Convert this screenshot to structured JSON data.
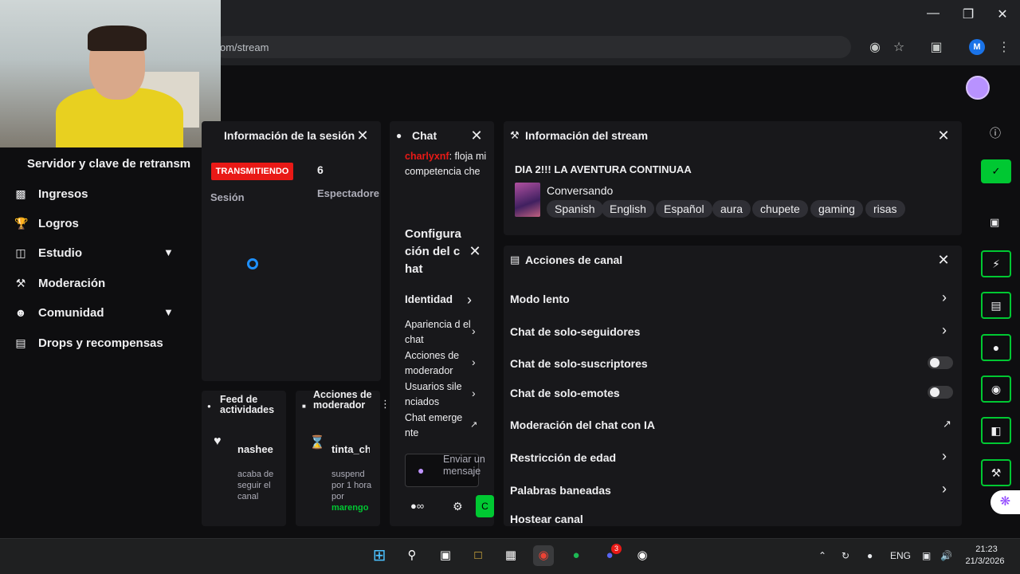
{
  "browser": {
    "url": "om/stream",
    "profile_initial": "M"
  },
  "sidebar": {
    "title": "Servidor y clave de retransm",
    "items": [
      {
        "label": "Ingresos",
        "icon": "bar-chart-icon"
      },
      {
        "label": "Logros",
        "icon": "trophy-icon"
      },
      {
        "label": "Estudio",
        "icon": "studio-icon"
      },
      {
        "label": "Moderación",
        "icon": "wrench-icon"
      },
      {
        "label": "Comunidad",
        "icon": "people-icon"
      },
      {
        "label": "Drops y recompensas",
        "icon": "gift-icon"
      }
    ]
  },
  "session": {
    "title": "Información de la sesión",
    "live_badge": "TRANSMITIENDO",
    "session_label": "Sesión",
    "viewers_value": "6",
    "viewers_label": "Espectadore"
  },
  "chat": {
    "title": "Chat",
    "msg_user": "charlyxnf",
    "msg_text": ": floja mi competencia che",
    "config_title": "Configura ción del c hat",
    "config_items": [
      {
        "label": "Identidad"
      },
      {
        "label": "Apariencia d el chat"
      },
      {
        "label": "Acciones de moderador"
      },
      {
        "label": "Usuarios sile nciados"
      },
      {
        "label": "Chat emerge nte"
      }
    ],
    "input_placeholder": "Enviar un mensaje",
    "send_label": "C"
  },
  "stream_info": {
    "title": "Información del stream",
    "stream_title": "DIA 2!!! LA AVENTURA CONTINUAA",
    "category": "Conversando",
    "tags": [
      "Spanish",
      "English",
      "Español",
      "aura",
      "chupete",
      "gaming",
      "risas"
    ]
  },
  "channel_actions": {
    "title": "Acciones de canal",
    "rows": [
      {
        "label": "Modo lento",
        "control": "arrow"
      },
      {
        "label": "Chat de solo-seguidores",
        "control": "arrow"
      },
      {
        "label": "Chat de solo-suscriptores",
        "control": "toggle",
        "on": false
      },
      {
        "label": "Chat de solo-emotes",
        "control": "toggle",
        "on": false
      },
      {
        "label": "Moderación del chat con IA",
        "control": "external"
      },
      {
        "label": "Restricción de edad",
        "control": "arrow"
      },
      {
        "label": "Palabras baneadas",
        "control": "arrow"
      },
      {
        "label": "Hostear canal",
        "control": "none"
      }
    ]
  },
  "activity_feed": {
    "title": "Feed de actividades",
    "user": "nashee",
    "desc": "acaba de seguir el canal"
  },
  "mod_actions": {
    "title": "Acciones de moderador",
    "user": "tinta_ch",
    "desc": "suspend por 1 hora por",
    "by": "marengo"
  },
  "taskbar": {
    "lang": "ENG",
    "time": "21:23",
    "date": "21/3/2026",
    "discord_badge": "3"
  },
  "colors": {
    "live_red": "#e91916",
    "accent_green": "#00c832",
    "accent_purple": "#9147ff",
    "chat_user": "#e91916"
  }
}
